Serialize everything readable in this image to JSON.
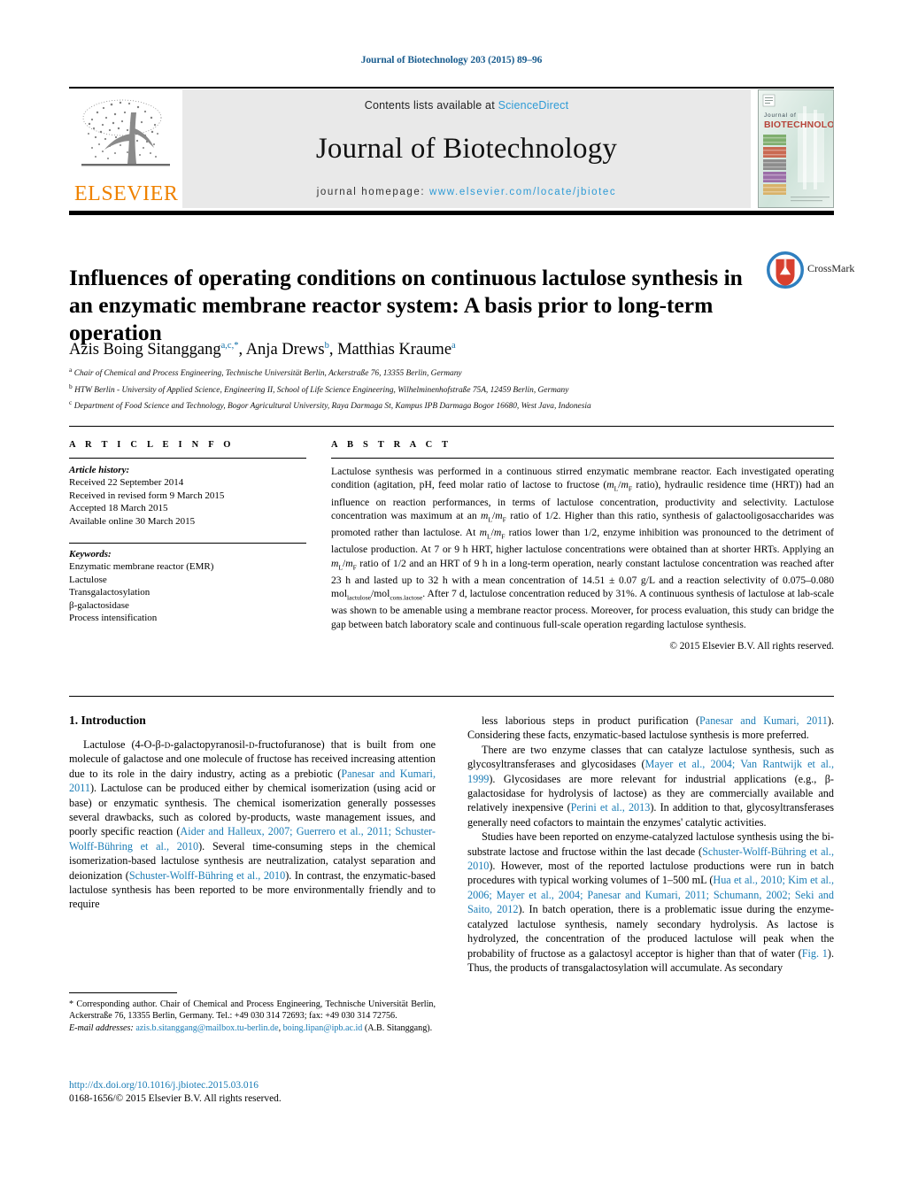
{
  "running_head": "Journal of Biotechnology 203 (2015) 89–96",
  "header": {
    "contents_prefix": "Contents lists available at",
    "sciencedirect": "ScienceDirect",
    "journal_name": "Journal of Biotechnology",
    "homepage_label": "journal homepage:",
    "homepage_url": "www.elsevier.com/locate/jbiotec",
    "publisher_wordmark": "ELSEVIER",
    "cover_line1": "Journal of",
    "cover_line2": "BIOTECHNOLOGY",
    "accent_orange": "#ef8200",
    "accent_link": "#2e9bd6"
  },
  "article": {
    "title": "Influences of operating conditions on continuous lactulose synthesis in an enzymatic membrane reactor system: A basis prior to long-term operation",
    "crossmark_label": "CrossMark",
    "authors_html": "Azis Boing Sitanggang<sup>a,c,</sup><sup>*</sup>, Anja Drews<sup>b</sup>, Matthias Kraume<sup>a</sup>",
    "affiliations": [
      {
        "mark": "a",
        "text": "Chair of Chemical and Process Engineering, Technische Universität Berlin, Ackerstraße 76, 13355 Berlin, Germany"
      },
      {
        "mark": "b",
        "text": "HTW Berlin - University of Applied Science, Engineering II, School of Life Science Engineering, Wilhelminenhofstraße 75A, 12459 Berlin, Germany"
      },
      {
        "mark": "c",
        "text": "Department of Food Science and Technology, Bogor Agricultural University, Raya Darmaga St, Kampus IPB Darmaga Bogor 16680, West Java, Indonesia"
      }
    ]
  },
  "article_info": {
    "heading": "A R T I C L E   I N F O",
    "history_label": "Article history:",
    "history": [
      "Received 22 September 2014",
      "Received in revised form 9 March 2015",
      "Accepted 18 March 2015",
      "Available online 30 March 2015"
    ],
    "keywords_label": "Keywords:",
    "keywords": [
      "Enzymatic membrane reactor (EMR)",
      "Lactulose",
      "Transgalactosylation",
      "β-galactosidase",
      "Process intensification"
    ]
  },
  "abstract": {
    "heading": "A B S T R A C T",
    "body_html": "Lactulose synthesis was performed in a continuous stirred enzymatic membrane reactor. Each investigated operating condition (agitation, pH, feed molar ratio of lactose to fructose (<i>m</i><sub>L</sub>/<i>m</i><sub>F</sub> ratio), hydraulic residence time (HRT)) had an influence on reaction performances, in terms of lactulose concentration, productivity and selectivity. Lactulose concentration was maximum at an <i>m</i><sub>L</sub>/<i>m</i><sub>F</sub> ratio of 1/2. Higher than this ratio, synthesis of galactooligosaccharides was promoted rather than lactulose. At <i>m</i><sub>L</sub>/<i>m</i><sub>F</sub> ratios lower than 1/2, enzyme inhibition was pronounced to the detriment of lactulose production. At 7 or 9 h HRT, higher lactulose concentrations were obtained than at shorter HRTs. Applying an <i>m</i><sub>L</sub>/<i>m</i><sub>F</sub> ratio of 1/2 and an HRT of 9 h in a long-term operation, nearly constant lactulose concentration was reached after 23 h and lasted up to 32 h with a mean concentration of 14.51 ± 0.07 g/L and a reaction selectivity of 0.075–0.080 mol<sub>lactulose</sub>/mol<sub>cons.lactose</sub>. After 7 d, lactulose concentration reduced by 31%. A continuous synthesis of lactulose at lab-scale was shown to be amenable using a membrane reactor process. Moreover, for process evaluation, this study can bridge the gap between batch laboratory scale and continuous full-scale operation regarding lactulose synthesis.",
    "copyright": "© 2015 Elsevier B.V. All rights reserved."
  },
  "introduction": {
    "section_title": "1.  Introduction",
    "left_paragraphs_html": [
      "Lactulose (4-O-β-<span style=\"font-variant:small-caps\">d</span>-galactopyranosil-<span style=\"font-variant:small-caps\">d</span>-fructofuranose) that is built from one molecule of galactose and one molecule of fructose has received increasing attention due to its role in the dairy industry, acting as a prebiotic (<span class=\"ref\">Panesar and Kumari, 2011</span>). Lactulose can be produced either by chemical isomerization (using acid or base) or enzymatic synthesis. The chemical isomerization generally possesses several drawbacks, such as colored by-products, waste management issues, and poorly specific reaction (<span class=\"ref\">Aider and Halleux, 2007; Guerrero et al., 2011; Schuster-Wolff-Bühring et al., 2010</span>). Several time-consuming steps in the chemical isomerization-based lactulose synthesis are neutralization, catalyst separation and deionization (<span class=\"ref\">Schuster-Wolff-Bühring et al., 2010</span>). In contrast, the enzymatic-based lactulose synthesis has been reported to be more environmentally friendly and to require"
    ],
    "right_paragraphs_html": [
      "less laborious steps in product purification (<span class=\"ref\">Panesar and Kumari, 2011</span>). Considering these facts, enzymatic-based lactulose synthesis is more preferred.",
      "There are two enzyme classes that can catalyze lactulose synthesis, such as glycosyltransferases and glycosidases (<span class=\"ref\">Mayer et al., 2004; Van Rantwijk et al., 1999</span>). Glycosidases are more relevant for industrial applications (e.g., β-galactosidase for hydrolysis of lactose) as they are commercially available and relatively inexpensive (<span class=\"ref\">Perini et al., 2013</span>). In addition to that, glycosyltransferases generally need cofactors to maintain the enzymes' catalytic activities.",
      "Studies have been reported on enzyme-catalyzed lactulose synthesis using the bi-substrate lactose and fructose within the last decade (<span class=\"ref\">Schuster-Wolff-Bühring et al., 2010</span>). However, most of the reported lactulose productions were run in batch procedures with typical working volumes of 1–500 mL (<span class=\"ref\">Hua et al., 2010; Kim et al., 2006; Mayer et al., 2004; Panesar and Kumari, 2011; Schumann, 2002; Seki and Saito, 2012</span>). In batch operation, there is a problematic issue during the enzyme-catalyzed lactulose synthesis, namely secondary hydrolysis. As lactose is hydrolyzed, the concentration of the produced lactulose will peak when the probability of fructose as a galactosyl acceptor is higher than that of water (<span class=\"ref\">Fig. 1</span>). Thus, the products of transgalactosylation will accumulate. As secondary"
    ]
  },
  "footnotes": {
    "corresponding_html": "<span class=\"star\">*</span>  Corresponding author. Chair of Chemical and Process Engineering, Technische Universität Berlin, Ackerstraße 76, 13355 Berlin, Germany. Tel.: +49 030 314 72693; fax: +49 030 314 72756.",
    "email_html": "<span class=\"fn-email-label\">E-mail addresses:</span> <span class=\"fn-link\">azis.b.sitanggang@mailbox.tu-berlin.de</span>, <span class=\"fn-link\">boing.lipan@ipb.ac.id</span> (A.B. Sitanggang)."
  },
  "doi": {
    "url": "http://dx.doi.org/10.1016/j.jbiotec.2015.03.016",
    "issn_line": "0168-1656/© 2015 Elsevier B.V. All rights reserved."
  }
}
